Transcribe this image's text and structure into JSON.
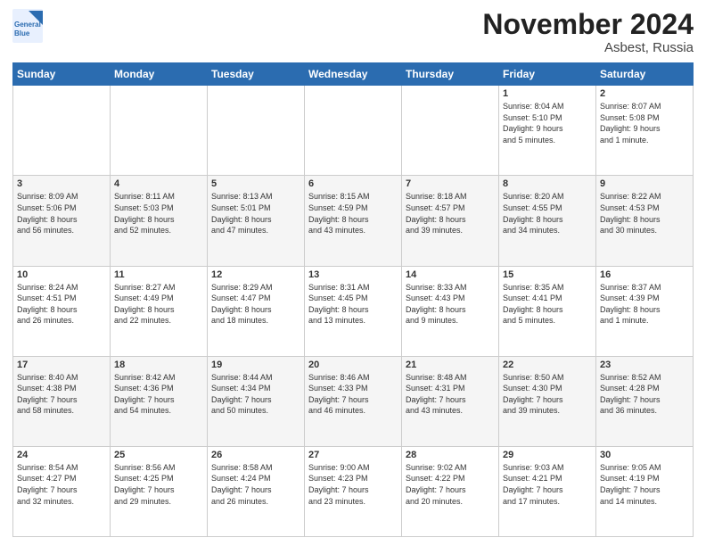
{
  "header": {
    "logo_line1": "General",
    "logo_line2": "Blue",
    "month": "November 2024",
    "location": "Asbest, Russia"
  },
  "days_of_week": [
    "Sunday",
    "Monday",
    "Tuesday",
    "Wednesday",
    "Thursday",
    "Friday",
    "Saturday"
  ],
  "weeks": [
    [
      {
        "num": "",
        "info": ""
      },
      {
        "num": "",
        "info": ""
      },
      {
        "num": "",
        "info": ""
      },
      {
        "num": "",
        "info": ""
      },
      {
        "num": "",
        "info": ""
      },
      {
        "num": "1",
        "info": "Sunrise: 8:04 AM\nSunset: 5:10 PM\nDaylight: 9 hours\nand 5 minutes."
      },
      {
        "num": "2",
        "info": "Sunrise: 8:07 AM\nSunset: 5:08 PM\nDaylight: 9 hours\nand 1 minute."
      }
    ],
    [
      {
        "num": "3",
        "info": "Sunrise: 8:09 AM\nSunset: 5:06 PM\nDaylight: 8 hours\nand 56 minutes."
      },
      {
        "num": "4",
        "info": "Sunrise: 8:11 AM\nSunset: 5:03 PM\nDaylight: 8 hours\nand 52 minutes."
      },
      {
        "num": "5",
        "info": "Sunrise: 8:13 AM\nSunset: 5:01 PM\nDaylight: 8 hours\nand 47 minutes."
      },
      {
        "num": "6",
        "info": "Sunrise: 8:15 AM\nSunset: 4:59 PM\nDaylight: 8 hours\nand 43 minutes."
      },
      {
        "num": "7",
        "info": "Sunrise: 8:18 AM\nSunset: 4:57 PM\nDaylight: 8 hours\nand 39 minutes."
      },
      {
        "num": "8",
        "info": "Sunrise: 8:20 AM\nSunset: 4:55 PM\nDaylight: 8 hours\nand 34 minutes."
      },
      {
        "num": "9",
        "info": "Sunrise: 8:22 AM\nSunset: 4:53 PM\nDaylight: 8 hours\nand 30 minutes."
      }
    ],
    [
      {
        "num": "10",
        "info": "Sunrise: 8:24 AM\nSunset: 4:51 PM\nDaylight: 8 hours\nand 26 minutes."
      },
      {
        "num": "11",
        "info": "Sunrise: 8:27 AM\nSunset: 4:49 PM\nDaylight: 8 hours\nand 22 minutes."
      },
      {
        "num": "12",
        "info": "Sunrise: 8:29 AM\nSunset: 4:47 PM\nDaylight: 8 hours\nand 18 minutes."
      },
      {
        "num": "13",
        "info": "Sunrise: 8:31 AM\nSunset: 4:45 PM\nDaylight: 8 hours\nand 13 minutes."
      },
      {
        "num": "14",
        "info": "Sunrise: 8:33 AM\nSunset: 4:43 PM\nDaylight: 8 hours\nand 9 minutes."
      },
      {
        "num": "15",
        "info": "Sunrise: 8:35 AM\nSunset: 4:41 PM\nDaylight: 8 hours\nand 5 minutes."
      },
      {
        "num": "16",
        "info": "Sunrise: 8:37 AM\nSunset: 4:39 PM\nDaylight: 8 hours\nand 1 minute."
      }
    ],
    [
      {
        "num": "17",
        "info": "Sunrise: 8:40 AM\nSunset: 4:38 PM\nDaylight: 7 hours\nand 58 minutes."
      },
      {
        "num": "18",
        "info": "Sunrise: 8:42 AM\nSunset: 4:36 PM\nDaylight: 7 hours\nand 54 minutes."
      },
      {
        "num": "19",
        "info": "Sunrise: 8:44 AM\nSunset: 4:34 PM\nDaylight: 7 hours\nand 50 minutes."
      },
      {
        "num": "20",
        "info": "Sunrise: 8:46 AM\nSunset: 4:33 PM\nDaylight: 7 hours\nand 46 minutes."
      },
      {
        "num": "21",
        "info": "Sunrise: 8:48 AM\nSunset: 4:31 PM\nDaylight: 7 hours\nand 43 minutes."
      },
      {
        "num": "22",
        "info": "Sunrise: 8:50 AM\nSunset: 4:30 PM\nDaylight: 7 hours\nand 39 minutes."
      },
      {
        "num": "23",
        "info": "Sunrise: 8:52 AM\nSunset: 4:28 PM\nDaylight: 7 hours\nand 36 minutes."
      }
    ],
    [
      {
        "num": "24",
        "info": "Sunrise: 8:54 AM\nSunset: 4:27 PM\nDaylight: 7 hours\nand 32 minutes."
      },
      {
        "num": "25",
        "info": "Sunrise: 8:56 AM\nSunset: 4:25 PM\nDaylight: 7 hours\nand 29 minutes."
      },
      {
        "num": "26",
        "info": "Sunrise: 8:58 AM\nSunset: 4:24 PM\nDaylight: 7 hours\nand 26 minutes."
      },
      {
        "num": "27",
        "info": "Sunrise: 9:00 AM\nSunset: 4:23 PM\nDaylight: 7 hours\nand 23 minutes."
      },
      {
        "num": "28",
        "info": "Sunrise: 9:02 AM\nSunset: 4:22 PM\nDaylight: 7 hours\nand 20 minutes."
      },
      {
        "num": "29",
        "info": "Sunrise: 9:03 AM\nSunset: 4:21 PM\nDaylight: 7 hours\nand 17 minutes."
      },
      {
        "num": "30",
        "info": "Sunrise: 9:05 AM\nSunset: 4:19 PM\nDaylight: 7 hours\nand 14 minutes."
      }
    ]
  ]
}
